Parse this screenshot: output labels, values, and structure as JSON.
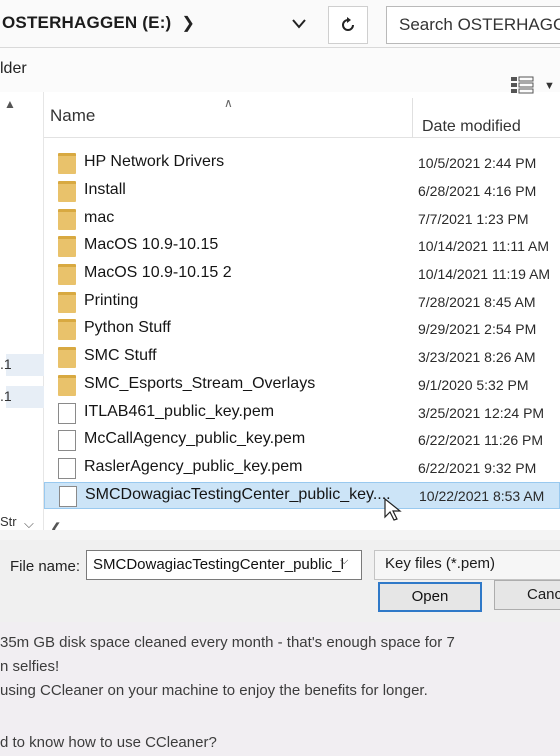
{
  "address_bar": {
    "path": "OSTERHAGGEN (E:)",
    "search_placeholder": "Search OSTERHAGGEN"
  },
  "toolbar": {
    "new_folder_label": "lder"
  },
  "columns": {
    "name": "Name",
    "date_modified": "Date modified"
  },
  "nav": {
    "item_1": ".1",
    "item_2": ".1",
    "item_3": "Str"
  },
  "files": [
    {
      "name": "HP Network Drivers",
      "date": "10/5/2021 2:44 PM",
      "type": "folder"
    },
    {
      "name": "Install",
      "date": "6/28/2021 4:16 PM",
      "type": "folder"
    },
    {
      "name": "mac",
      "date": "7/7/2021 1:23 PM",
      "type": "folder"
    },
    {
      "name": "MacOS 10.9-10.15",
      "date": "10/14/2021 11:11 AM",
      "type": "folder"
    },
    {
      "name": "MacOS 10.9-10.15 2",
      "date": "10/14/2021 11:19 AM",
      "type": "folder"
    },
    {
      "name": "Printing",
      "date": "7/28/2021 8:45 AM",
      "type": "folder"
    },
    {
      "name": "Python Stuff",
      "date": "9/29/2021 2:54 PM",
      "type": "folder"
    },
    {
      "name": "SMC Stuff",
      "date": "3/23/2021 8:26 AM",
      "type": "folder"
    },
    {
      "name": "SMC_Esports_Stream_Overlays",
      "date": "9/1/2020 5:32 PM",
      "type": "folder"
    },
    {
      "name": "ITLAB461_public_key.pem",
      "date": "3/25/2021 12:24 PM",
      "type": "file"
    },
    {
      "name": "McCallAgency_public_key.pem",
      "date": "6/22/2021 11:26 PM",
      "type": "file"
    },
    {
      "name": "RaslerAgency_public_key.pem",
      "date": "6/22/2021 9:32 PM",
      "type": "file"
    },
    {
      "name": "SMCDowagiacTestingCenter_public_key....",
      "date": "10/22/2021 8:53 AM",
      "type": "file",
      "selected": true
    }
  ],
  "bottom": {
    "file_name_label": "File name:",
    "file_name_value": "SMCDowagiacTestingCenter_public_l",
    "file_type": "Key files (*.pem)",
    "open_label": "Open",
    "cancel_label": "Cance"
  },
  "background": {
    "line1": "35m GB disk space cleaned every month - that's enough space for 7",
    "line2": "n selfies!",
    "line3": "using CCleaner on your machine to enjoy the benefits for longer.",
    "line4": "d to know how to use CCleaner?"
  },
  "colors": {
    "folder": "#e9c26b",
    "selection": "#cce4f7",
    "focus_border": "#2f79c8"
  }
}
